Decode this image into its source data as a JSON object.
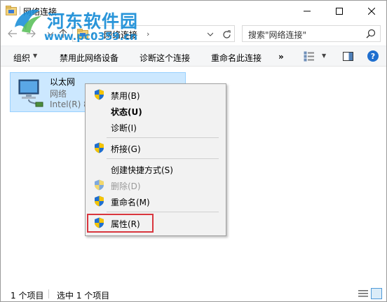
{
  "window": {
    "title": "网络连接"
  },
  "watermark": {
    "text": "河东软件园",
    "url": "www.pc0359.cn"
  },
  "address": {
    "path_label": "网络连接"
  },
  "search": {
    "placeholder": "搜索\"网络连接\""
  },
  "commands": {
    "organize": "组织",
    "disable": "禁用此网络设备",
    "diagnose": "诊断这个连接",
    "rename": "重命名此连接",
    "more": "»"
  },
  "adapter": {
    "name": "以太网",
    "type": "网络",
    "device": "Intel(R) 8"
  },
  "context_menu": {
    "items": [
      {
        "label": "禁用(B)",
        "icon": "shield-icon",
        "style": "normal"
      },
      {
        "label": "状态(U)",
        "icon": "",
        "style": "bold"
      },
      {
        "label": "诊断(I)",
        "icon": "",
        "style": "normal"
      },
      {
        "label": "桥接(G)",
        "icon": "shield-icon",
        "style": "normal"
      },
      {
        "label": "创建快捷方式(S)",
        "icon": "",
        "style": "normal"
      },
      {
        "label": "删除(D)",
        "icon": "shield-icon",
        "style": "disabled"
      },
      {
        "label": "重命名(M)",
        "icon": "shield-icon",
        "style": "normal"
      },
      {
        "label": "属性(R)",
        "icon": "shield-icon",
        "style": "normal"
      }
    ]
  },
  "statusbar": {
    "item_count": "1 个项目",
    "selected": "选中 1 个项目"
  },
  "colors": {
    "selection": "#cce8ff",
    "highlight_border": "#d9363e",
    "watermark": "#1e90d8",
    "shield_blue": "#1f6fcf",
    "shield_yellow": "#f5c400"
  }
}
